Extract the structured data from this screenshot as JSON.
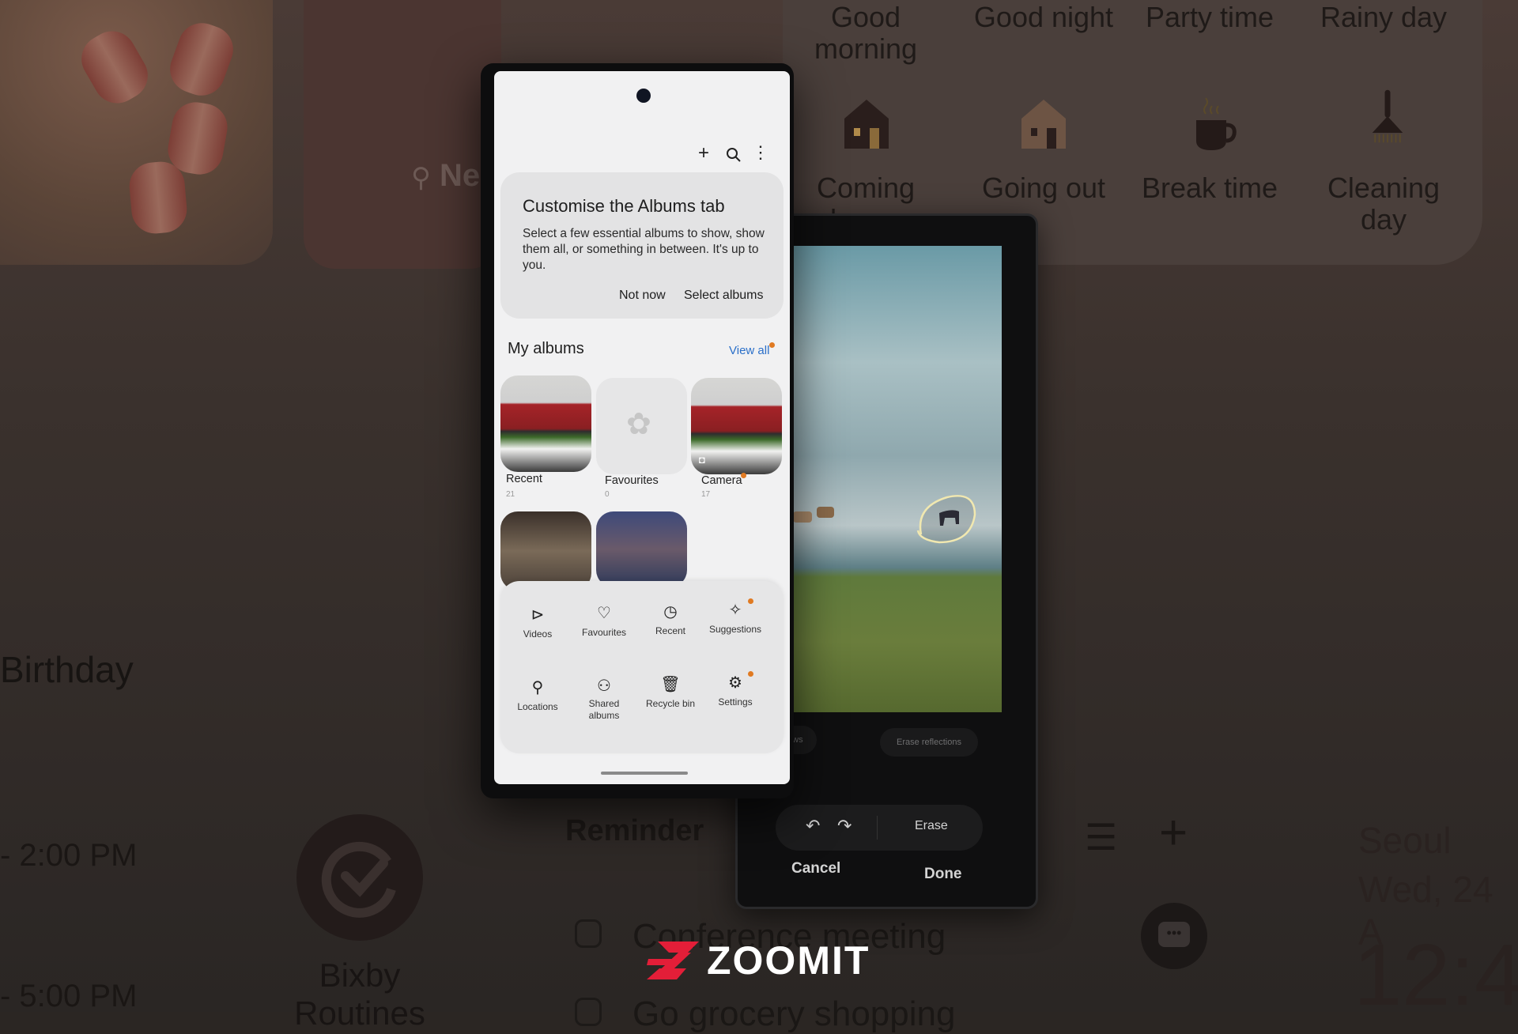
{
  "background": {
    "location_partial": "Ne",
    "routines": [
      {
        "label": "Good morning"
      },
      {
        "label": "Good night"
      },
      {
        "label": "Party time"
      },
      {
        "label": "Rainy day"
      },
      {
        "label": "Coming home",
        "icon": "house-icon"
      },
      {
        "label": "Going out",
        "icon": "house-icon"
      },
      {
        "label": "Break time",
        "icon": "coffee-cup-icon"
      },
      {
        "label": "Cleaning day",
        "icon": "broom-icon"
      }
    ],
    "calendar": {
      "event": "Birthday",
      "time1": "- 2:00 PM",
      "time2": "- 5:00 PM"
    },
    "bixby": {
      "label": "Bixby Routines"
    },
    "reminder": {
      "title": "Reminder",
      "items": [
        "Conference meeting",
        "Go grocery shopping"
      ]
    },
    "world_clock": {
      "city": "Seoul",
      "date": "Wed, 24 A",
      "time": "12:4"
    }
  },
  "gallery_phone": {
    "toolbar": {
      "add": "+",
      "search": "search",
      "more": "more"
    },
    "tip_card": {
      "title": "Customise the Albums tab",
      "body": "Select a few essential albums to show, show them all, or something in between. It's up to you.",
      "not_now": "Not now",
      "select_albums": "Select albums"
    },
    "my_albums": {
      "title": "My albums",
      "view_all": "View all",
      "albums": [
        {
          "name": "Recent",
          "count": "21"
        },
        {
          "name": "Favourites",
          "count": "0"
        },
        {
          "name": "Camera",
          "count": "17"
        }
      ]
    },
    "shortcuts": [
      {
        "label": "Videos",
        "icon": "play-video-icon"
      },
      {
        "label": "Favourites",
        "icon": "heart-icon"
      },
      {
        "label": "Recent",
        "icon": "clock-icon"
      },
      {
        "label": "Suggestions",
        "icon": "sparkle-chat-icon"
      },
      {
        "label": "Locations",
        "icon": "location-pin-icon"
      },
      {
        "label": "Shared albums",
        "icon": "people-icon"
      },
      {
        "label": "Recycle bin",
        "icon": "trash-icon"
      },
      {
        "label": "Settings",
        "icon": "gear-icon"
      }
    ],
    "accent_color": "#2a6fc9",
    "badge_color": "#e07a22"
  },
  "editor_phone": {
    "erase_shadows": "Erase shadows",
    "erase_reflections": "Erase reflections",
    "erase": "Erase",
    "cancel": "Cancel",
    "done": "Done"
  },
  "watermark": {
    "brand": "ZOOMIT",
    "brand_color": "#e31e38"
  }
}
